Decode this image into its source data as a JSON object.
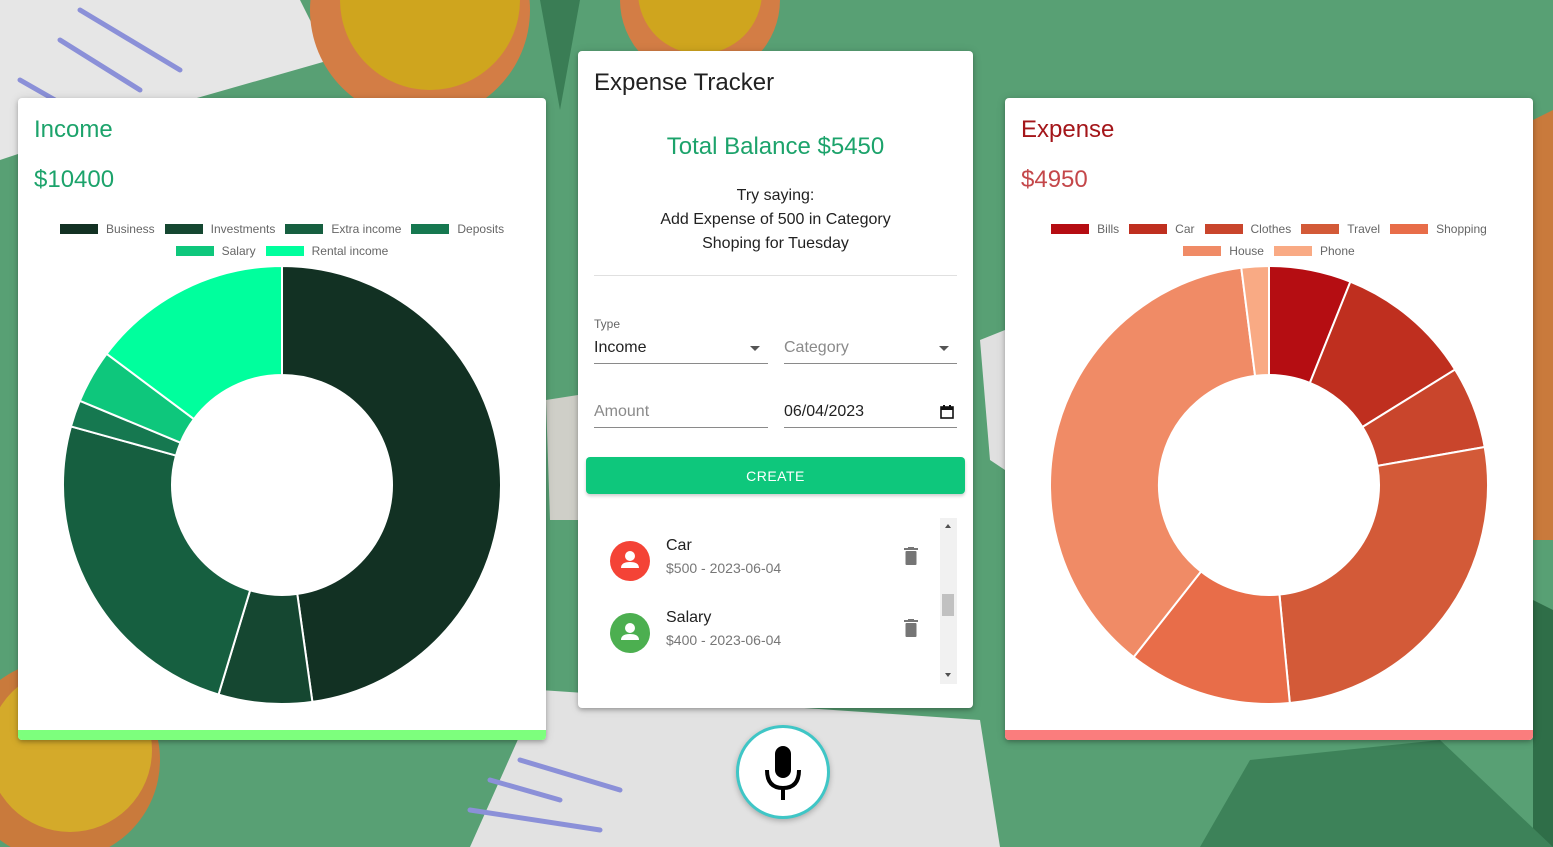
{
  "colors": {
    "income_accent": "#1ca36b",
    "expense_accent": "#a4161a",
    "income_bar": "#7dff7d",
    "expense_bar": "#fa7d7d",
    "create_button": "#0ec77c"
  },
  "income": {
    "title": "Income",
    "amount": "$10400"
  },
  "expense": {
    "title": "Expense",
    "amount": "$4950"
  },
  "tracker": {
    "title": "Expense Tracker",
    "balance": "Total Balance $5450",
    "hint_line1": "Try saying:",
    "hint_line2": "Add Expense of 500 in Category",
    "hint_line3": "Shoping for Tuesday",
    "type_label": "Type",
    "type_value": "Income",
    "category_placeholder": "Category",
    "amount_placeholder": "Amount",
    "date_value": "06/04/2023",
    "create_label": "CREATE",
    "transactions": [
      {
        "title": "Car",
        "subtitle": "$500 - 2023-06-04",
        "kind": "expense"
      },
      {
        "title": "Salary",
        "subtitle": "$400 - 2023-06-04",
        "kind": "income"
      }
    ]
  },
  "icons": {
    "avatar": "person-icon",
    "delete": "trash-icon",
    "date": "calendar-icon",
    "voice": "microphone-icon",
    "dropdown": "caret-down-icon"
  },
  "chart_data": [
    {
      "type": "pie",
      "categories": [
        "Business",
        "Investments",
        "Extra income",
        "Deposits",
        "Salary",
        "Rental income"
      ],
      "values": [
        4850,
        700,
        2500,
        200,
        400,
        1500
      ],
      "colors": [
        "#123123",
        "#154731",
        "#165f40",
        "#167850",
        "#0ec77c",
        "#00ff9d"
      ],
      "legend": "top"
    },
    {
      "type": "pie",
      "categories": [
        "Bills",
        "Car",
        "Clothes",
        "Travel",
        "Shopping",
        "House",
        "Phone"
      ],
      "values": [
        300,
        500,
        300,
        1300,
        600,
        1850,
        100
      ],
      "colors": [
        "#b50d12",
        "#bf2f1f",
        "#c9452c",
        "#d35a38",
        "#e86d49",
        "#f08b66",
        "#f9aa84"
      ],
      "legend": "top"
    }
  ]
}
